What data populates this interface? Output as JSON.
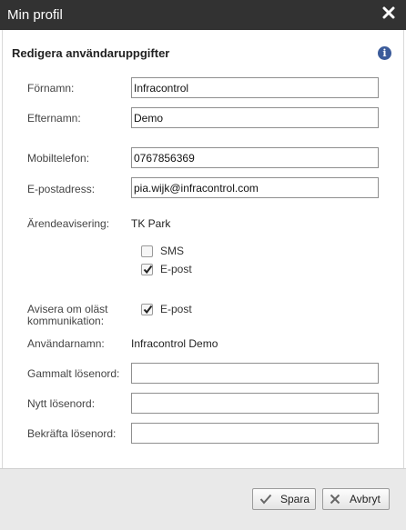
{
  "dialog": {
    "title": "Min profil"
  },
  "icons": {
    "close": "close-icon",
    "info": "info-icon",
    "check": "check-icon",
    "cross": "cross-icon"
  },
  "form": {
    "heading": "Redigera användaruppgifter",
    "first_name": {
      "label": "Förnamn:",
      "value": "Infracontrol"
    },
    "last_name": {
      "label": "Efternamn:",
      "value": "Demo"
    },
    "mobile": {
      "label": "Mobiltelefon:",
      "value": "0767856369"
    },
    "email": {
      "label": "E-postadress:",
      "value": "pia.wijk@infracontrol.com"
    },
    "case_notification": {
      "label": "Ärendeavisering:",
      "site": "TK Park",
      "sms": {
        "label": "SMS",
        "checked": false
      },
      "email": {
        "label": "E-post",
        "checked": true
      }
    },
    "unread_notification": {
      "label_line1": "Avisera om oläst",
      "label_line2": "kommunikation:",
      "email": {
        "label": "E-post",
        "checked": true
      }
    },
    "username": {
      "label": "Användarnamn:",
      "value": "Infracontrol Demo"
    },
    "old_password": {
      "label": "Gammalt lösenord:",
      "value": ""
    },
    "new_password": {
      "label": "Nytt lösenord:",
      "value": ""
    },
    "confirm_password": {
      "label": "Bekräfta lösenord:",
      "value": ""
    }
  },
  "buttons": {
    "save": "Spara",
    "cancel": "Avbryt"
  }
}
